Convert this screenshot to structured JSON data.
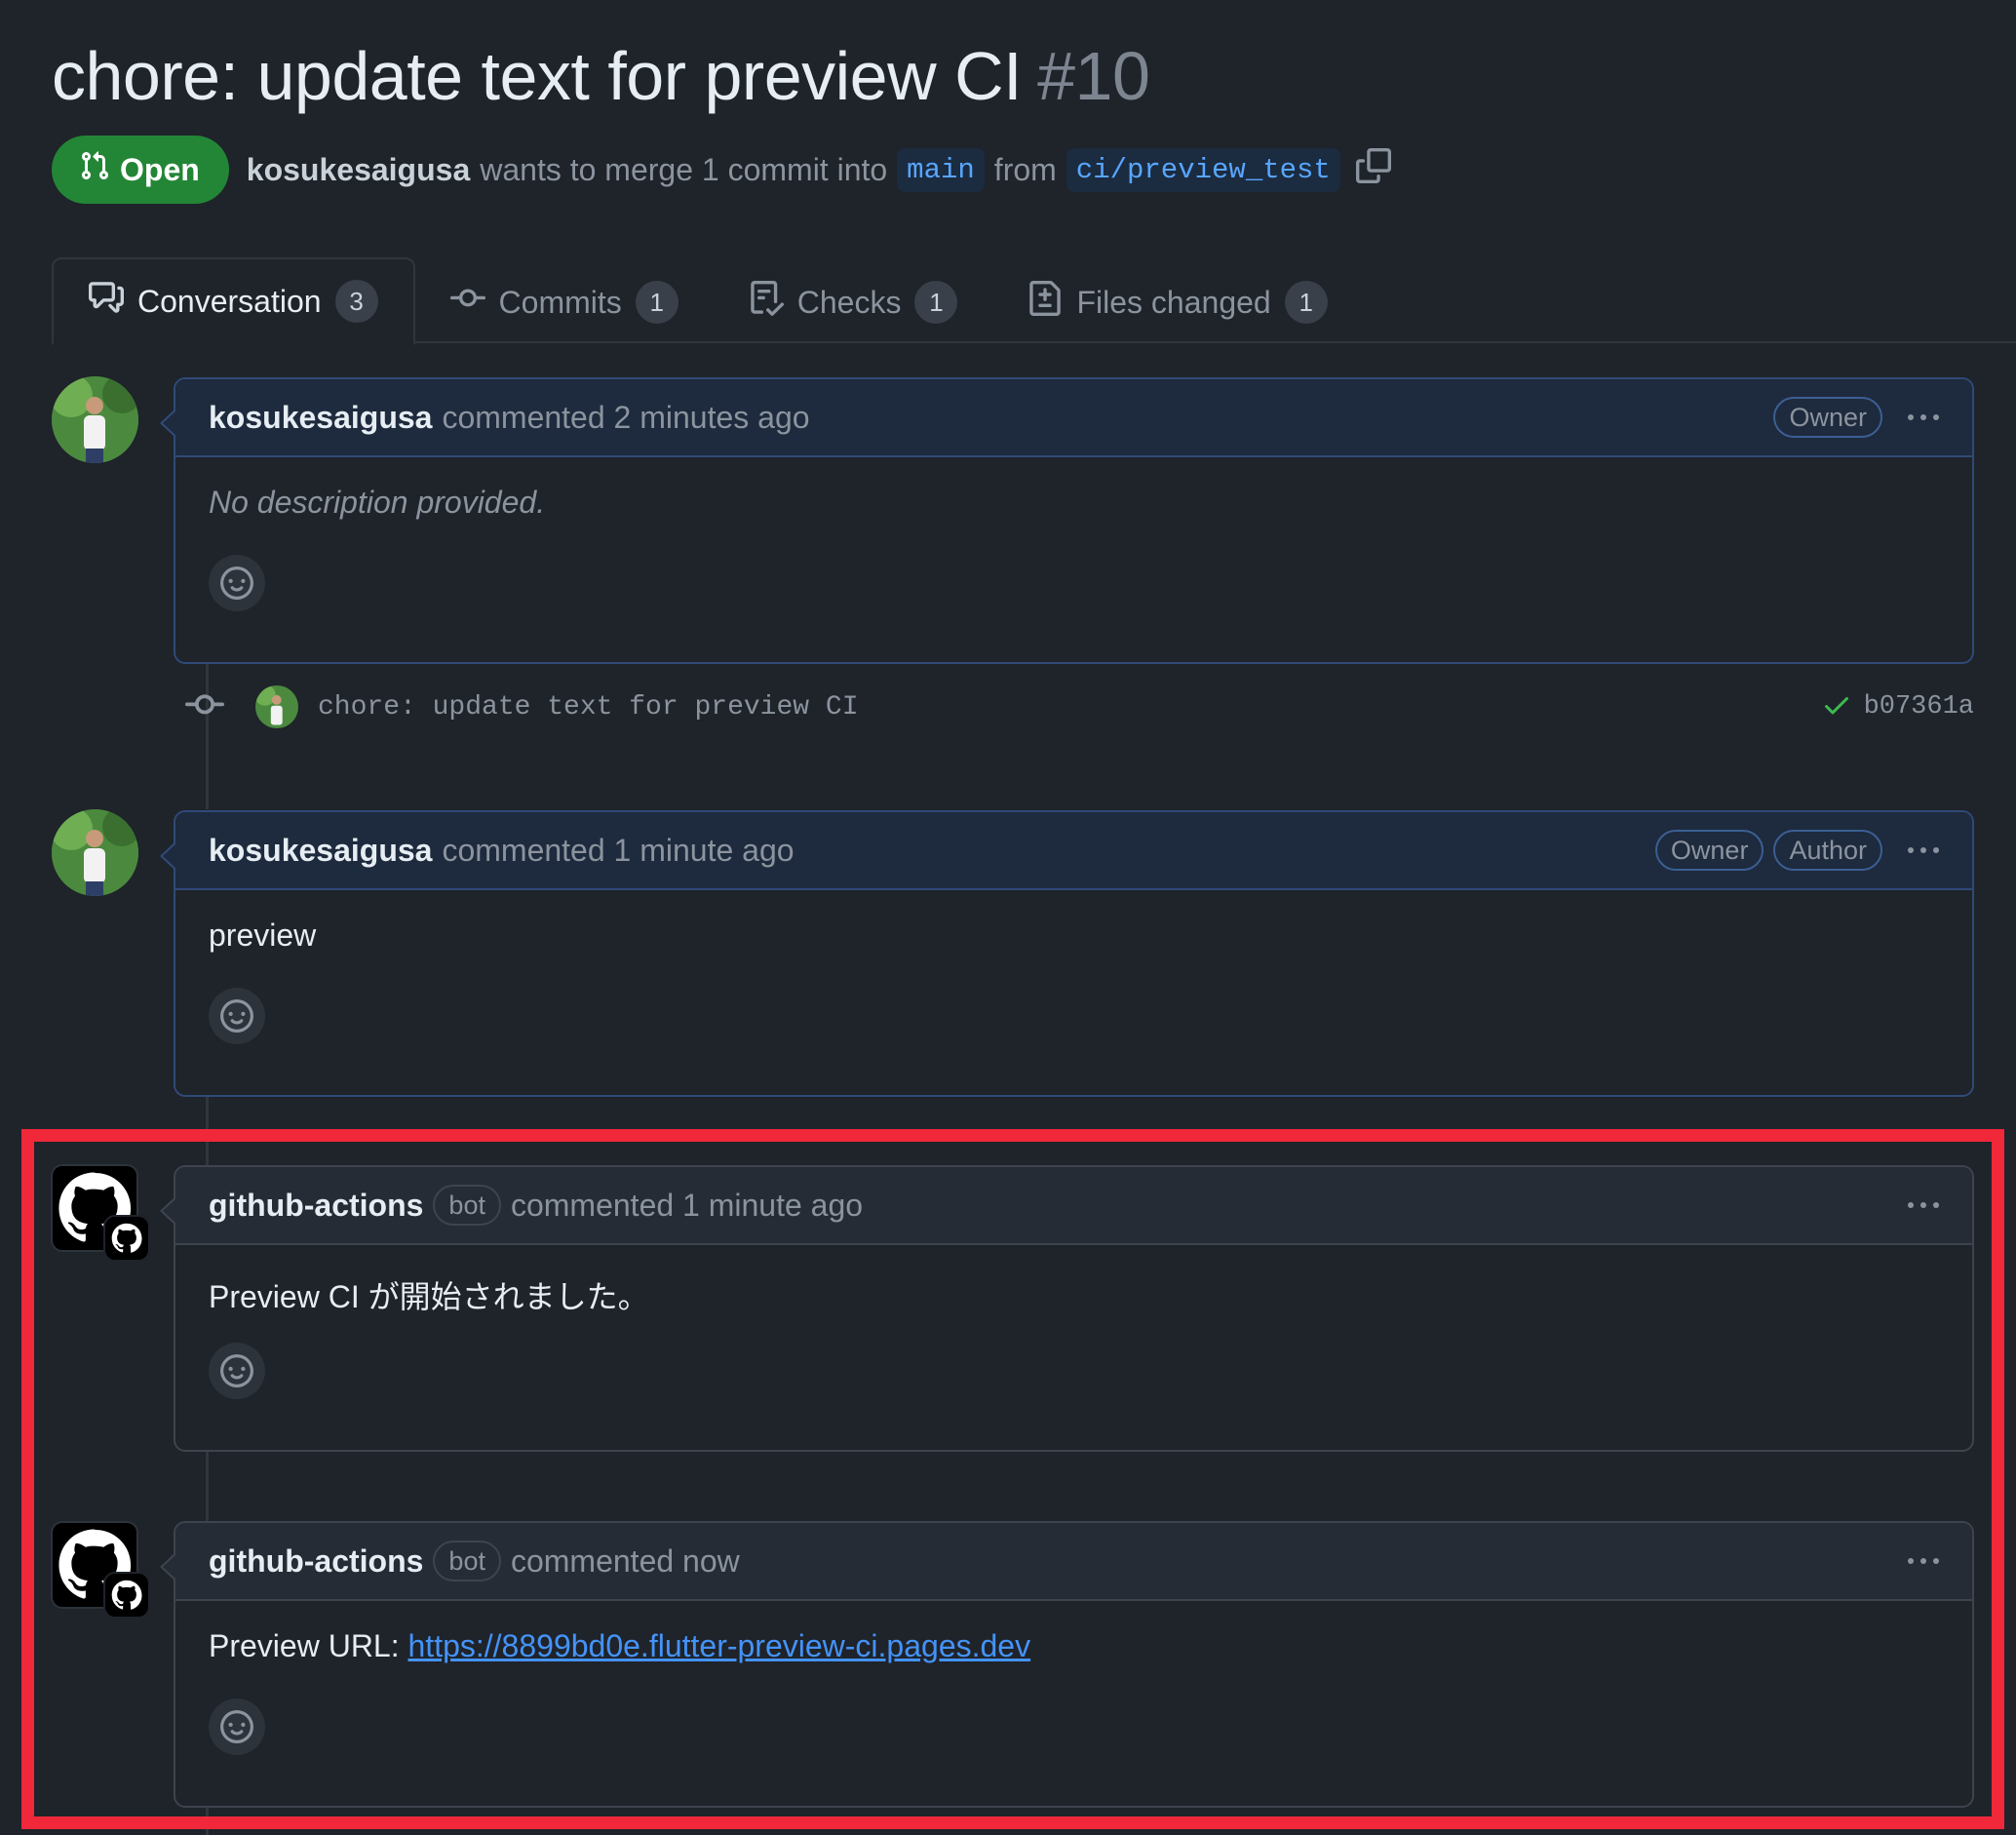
{
  "pr": {
    "title": "chore: update text for preview CI",
    "number": "#10",
    "state": "Open",
    "author": "kosukesaigusa",
    "merge_text_1": "wants to merge 1 commit into",
    "base_branch": "main",
    "merge_text_2": "from",
    "head_branch": "ci/preview_test"
  },
  "tabs": [
    {
      "label": "Conversation",
      "count": "3",
      "icon": "comment-discussion-icon"
    },
    {
      "label": "Commits",
      "count": "1",
      "icon": "git-commit-icon"
    },
    {
      "label": "Checks",
      "count": "1",
      "icon": "checklist-icon"
    },
    {
      "label": "Files changed",
      "count": "1",
      "icon": "file-diff-icon"
    }
  ],
  "comments": [
    {
      "author": "kosukesaigusa",
      "action": "commented 2 minutes ago",
      "labels": [
        "Owner"
      ],
      "body": "No description provided."
    },
    {
      "author": "kosukesaigusa",
      "action": "commented 1 minute ago",
      "labels": [
        "Owner",
        "Author"
      ],
      "body": "preview"
    },
    {
      "author": "github-actions",
      "bot_label": "bot",
      "action": "commented 1 minute ago",
      "body": "Preview CI が開始されました。"
    },
    {
      "author": "github-actions",
      "bot_label": "bot",
      "action": "commented now",
      "body_prefix": "Preview URL:",
      "link": "https://8899bd0e.flutter-preview-ci.pages.dev"
    }
  ],
  "commit": {
    "message": "chore: update text for preview CI",
    "sha": "b07361a",
    "status": "success"
  },
  "colors": {
    "background": "#1f232a",
    "open_green": "#238636",
    "link_blue": "#4493f8",
    "highlight_red": "#f0283a"
  }
}
